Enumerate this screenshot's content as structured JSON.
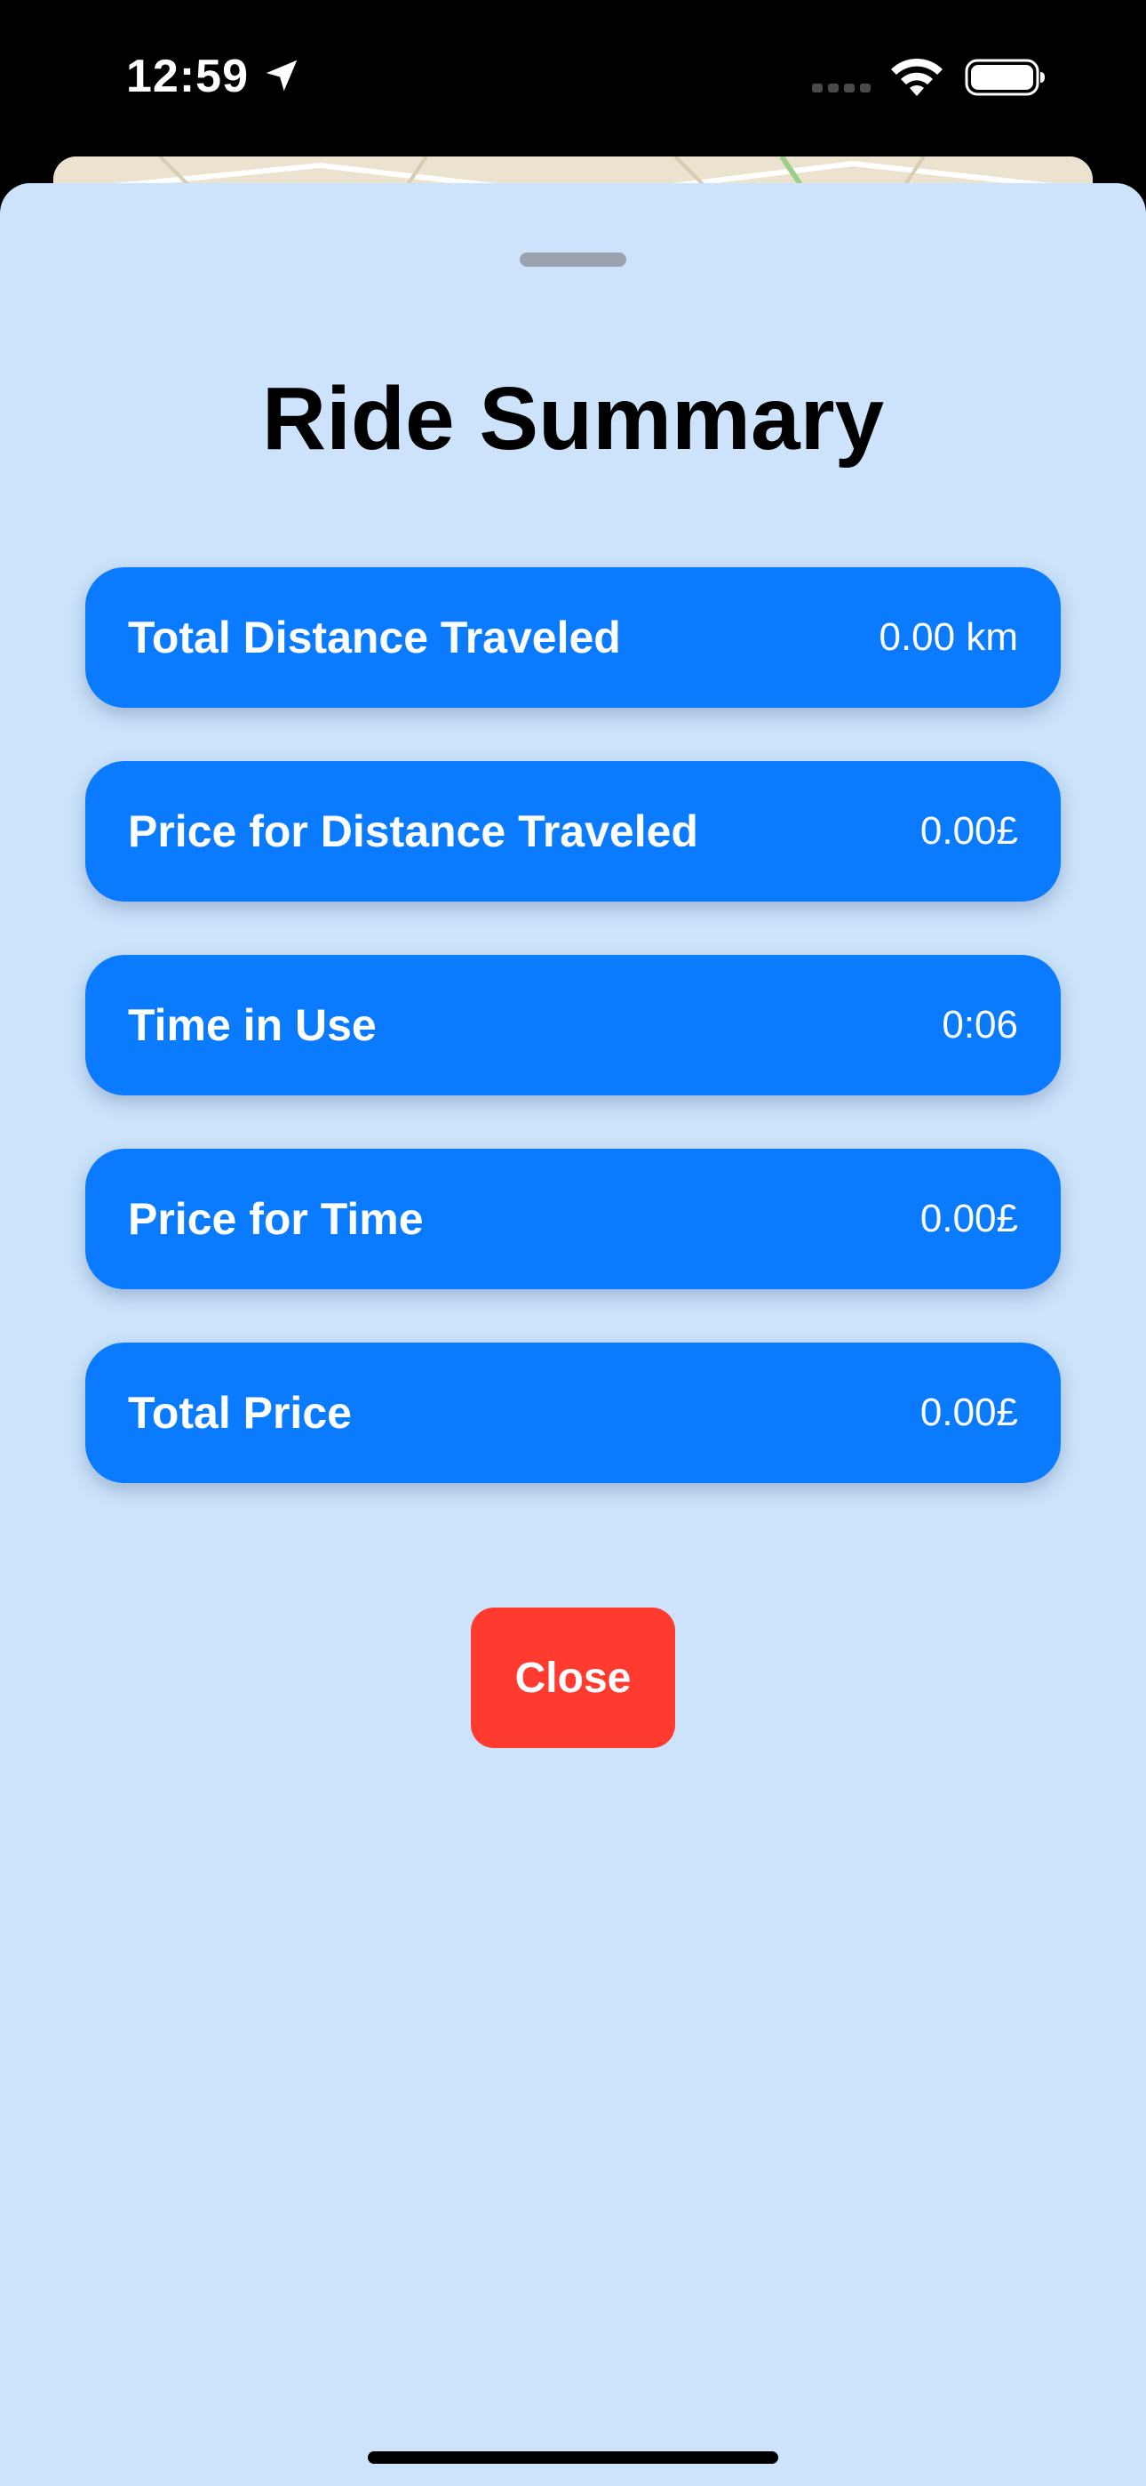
{
  "status_bar": {
    "time": "12:59",
    "icons": [
      "location-arrow-icon",
      "cellular-signal-icon",
      "wifi-icon",
      "battery-icon"
    ]
  },
  "sheet": {
    "title": "Ride Summary",
    "rows": [
      {
        "label": "Total Distance Traveled",
        "value": "0.00 km"
      },
      {
        "label": "Price for Distance Traveled",
        "value": "0.00£"
      },
      {
        "label": "Time in Use",
        "value": "0:06"
      },
      {
        "label": "Price for Time",
        "value": "0.00£"
      },
      {
        "label": "Total Price",
        "value": "0.00£"
      }
    ],
    "close_label": "Close"
  },
  "colors": {
    "sheet_background": "#cce3fb",
    "row_background": "#0a7bff",
    "close_background": "#ff3b30",
    "status_bar_background": "#000000"
  }
}
